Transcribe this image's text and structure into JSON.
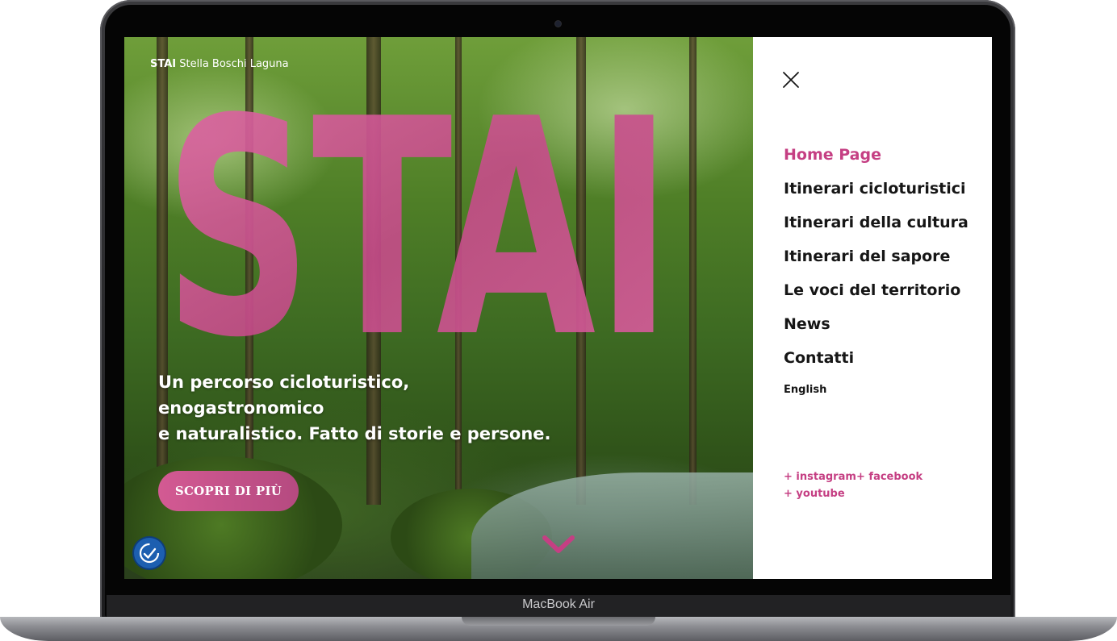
{
  "device": {
    "model_label": "MacBook Air"
  },
  "hero": {
    "logo_bold": "STAI",
    "logo_rest": "Stella Boschi Laguna",
    "big_wordmark": "STAI",
    "tagline_line1": "Un percorso cicloturistico, enogastronomico",
    "tagline_line2": "e naturalistico. Fatto di storie e persone.",
    "cta_label": "SCOPRI DI PIÙ",
    "accessibility_icon": "accessibility-check-icon",
    "scroll_icon": "chevron-down-icon"
  },
  "menu": {
    "close_icon": "close-icon",
    "items": [
      {
        "label": "Home Page",
        "active": true
      },
      {
        "label": "Itinerari cicloturistici",
        "active": false
      },
      {
        "label": "Itinerari della cultura",
        "active": false
      },
      {
        "label": "Itinerari del sapore",
        "active": false
      },
      {
        "label": "Le voci del territorio",
        "active": false
      },
      {
        "label": "News",
        "active": false
      },
      {
        "label": "Contatti",
        "active": false
      }
    ],
    "language": "English",
    "social": {
      "instagram": "+ instagram",
      "facebook": "+ facebook",
      "youtube": "+ youtube"
    }
  },
  "colors": {
    "accent": "#c53f83",
    "cta_gradient_start": "#d35a93",
    "cta_gradient_end": "#b54a80",
    "accessibility_blue": "#1d5fb0"
  }
}
